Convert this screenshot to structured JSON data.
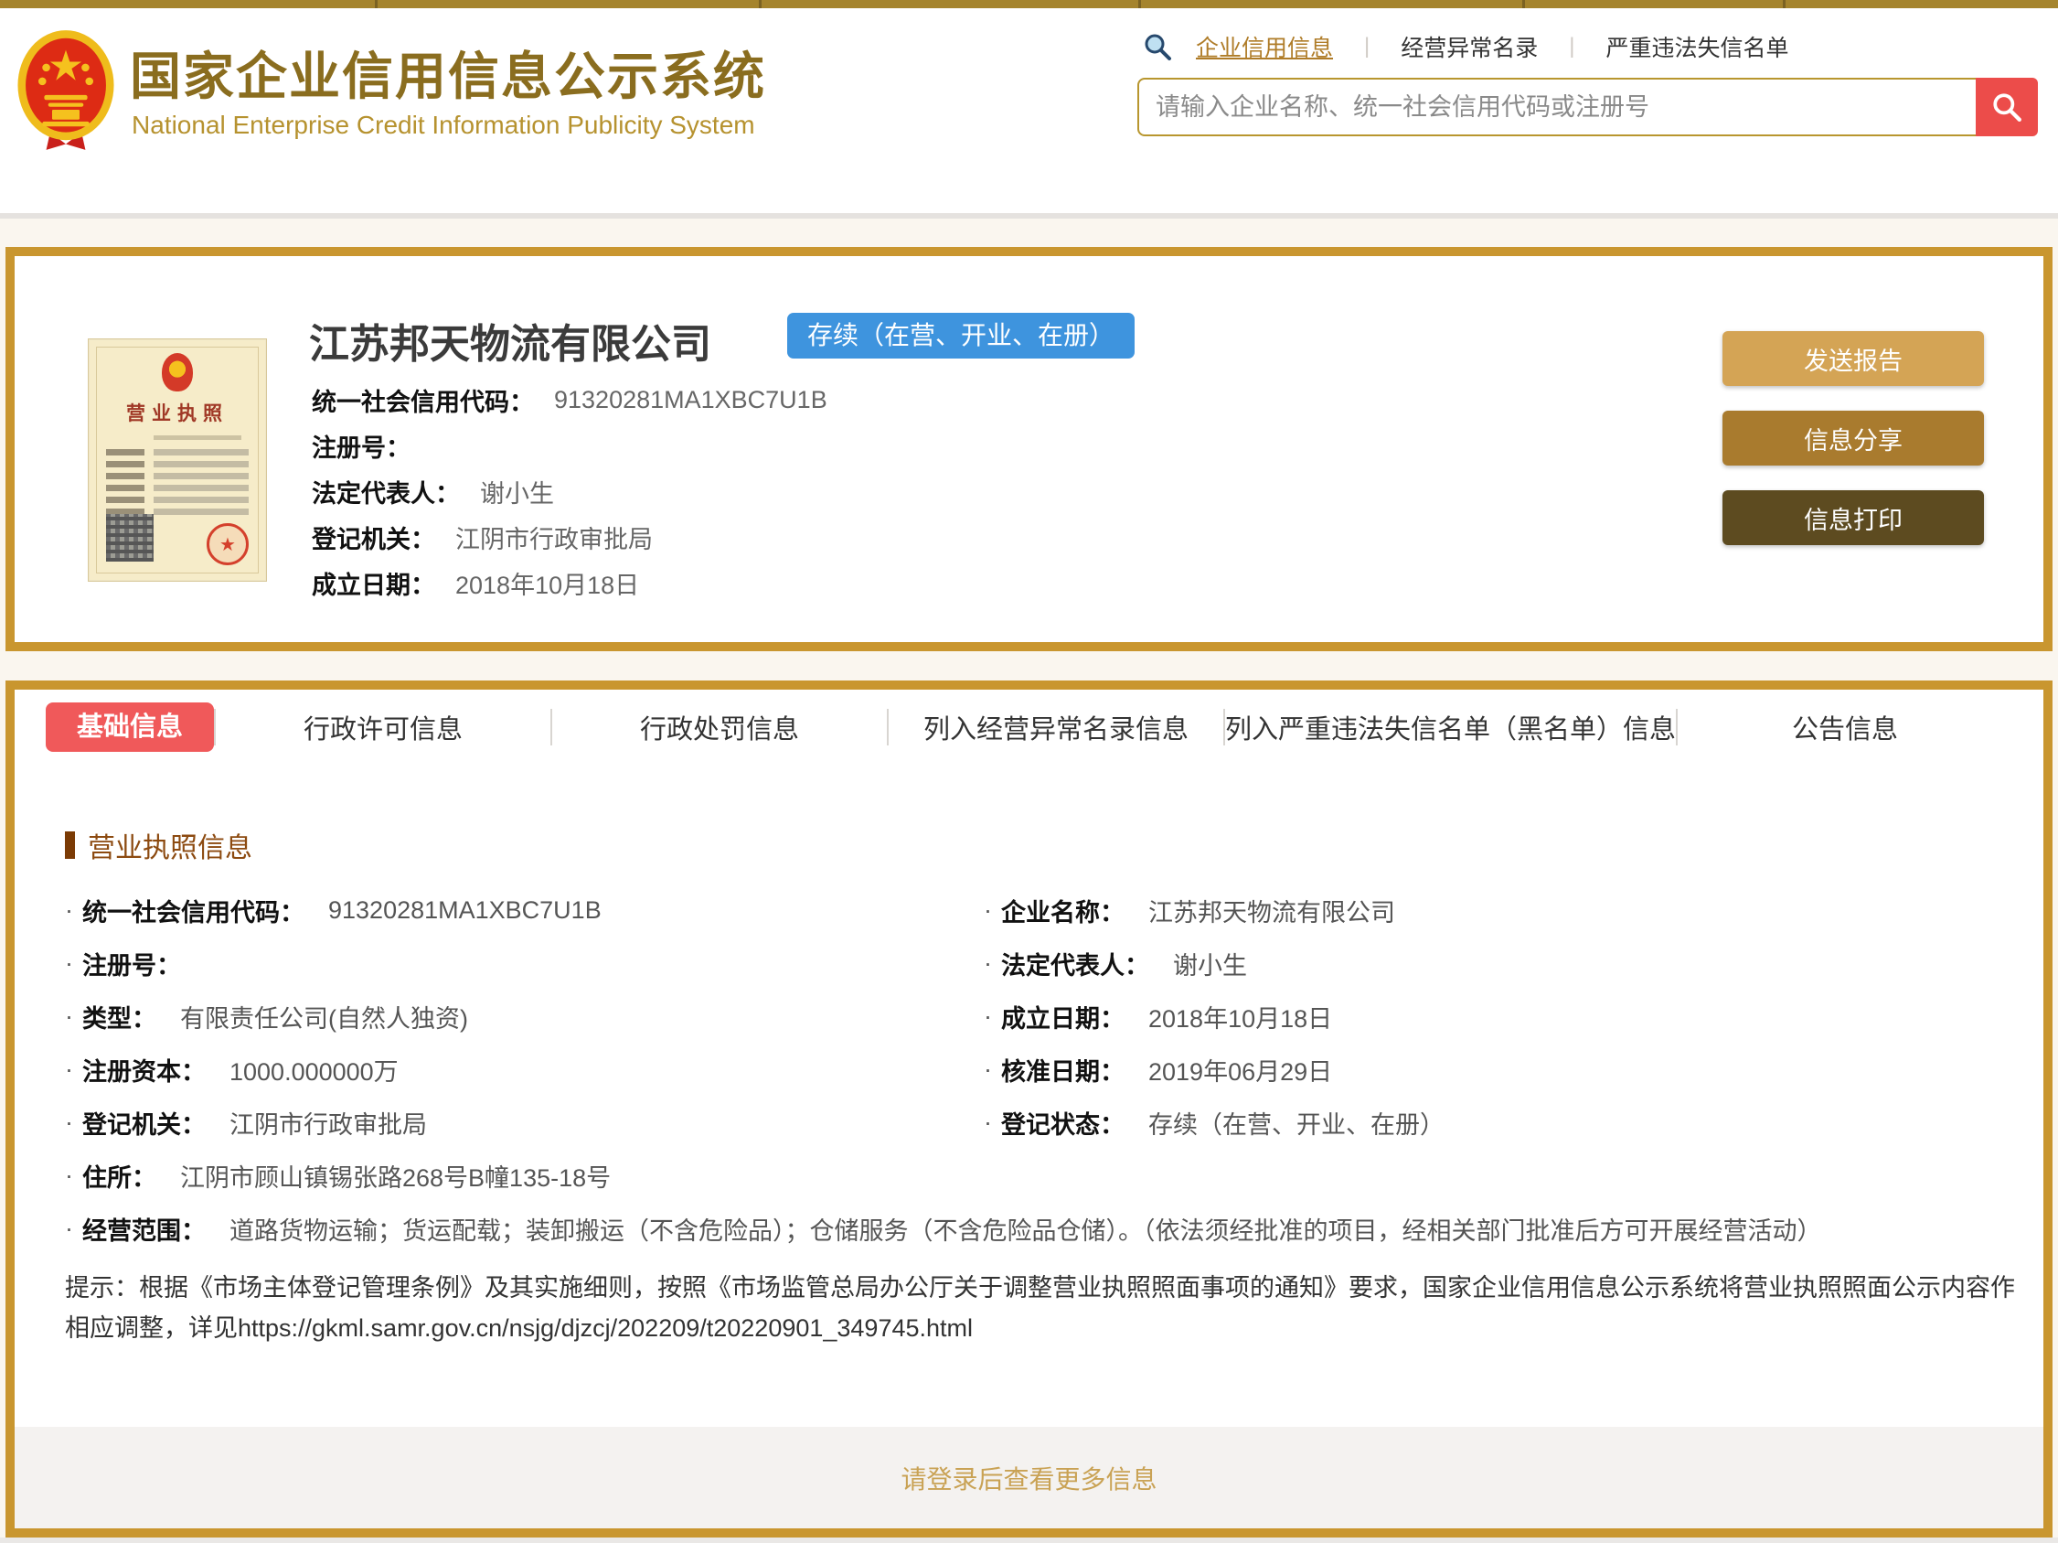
{
  "header": {
    "title_cn": "国家企业信用信息公示系统",
    "title_en": "National Enterprise Credit Information Publicity System",
    "nav": [
      {
        "label": "企业信用信息"
      },
      {
        "label": "经营异常名录"
      },
      {
        "label": "严重违法失信名单"
      }
    ],
    "search_placeholder": "请输入企业名称、统一社会信用代码或注册号"
  },
  "company": {
    "name": "江苏邦天物流有限公司",
    "status": "存续（在营、开业、在册）",
    "license_title": "营业执照",
    "fields": [
      {
        "label": "统一社会信用代码：",
        "value": "91320281MA1XBC7U1B"
      },
      {
        "label": "注册号：",
        "value": ""
      },
      {
        "label": "法定代表人：",
        "value": "谢小生"
      },
      {
        "label": "登记机关：",
        "value": "江阴市行政审批局"
      },
      {
        "label": "成立日期：",
        "value": "2018年10月18日"
      }
    ],
    "actions": [
      {
        "label": "发送报告"
      },
      {
        "label": "信息分享"
      },
      {
        "label": "信息打印"
      }
    ]
  },
  "tabs": [
    {
      "label": "基础信息",
      "active": true
    },
    {
      "label": "行政许可信息"
    },
    {
      "label": "行政处罚信息"
    },
    {
      "label": "列入经营异常名录信息"
    },
    {
      "label": "列入严重违法失信名单（黑名单）信息"
    },
    {
      "label": "公告信息"
    }
  ],
  "license_info": {
    "heading": "营业执照信息",
    "rows": [
      {
        "left_label": "统一社会信用代码：",
        "left_value": "91320281MA1XBC7U1B",
        "right_label": "企业名称：",
        "right_value": "江苏邦天物流有限公司"
      },
      {
        "left_label": "注册号：",
        "left_value": "",
        "right_label": "法定代表人：",
        "right_value": "谢小生"
      },
      {
        "left_label": "类型：",
        "left_value": "有限责任公司(自然人独资)",
        "right_label": "成立日期：",
        "right_value": "2018年10月18日"
      },
      {
        "left_label": "注册资本：",
        "left_value": "1000.000000万",
        "right_label": "核准日期：",
        "right_value": "2019年06月29日"
      },
      {
        "left_label": "登记机关：",
        "left_value": "江阴市行政审批局",
        "right_label": "登记状态：",
        "right_value": "存续（在营、开业、在册）"
      }
    ],
    "full_rows": [
      {
        "label": "住所：",
        "value": "江阴市顾山镇锡张路268号B幢135-18号"
      },
      {
        "label": "经营范围：",
        "value": "道路货物运输；货运配载；装卸搬运（不含危险品）；仓储服务（不含危险品仓储）。（依法须经批准的项目，经相关部门批准后方可开展经营活动）"
      }
    ],
    "hint": "提示：根据《市场主体登记管理条例》及其实施细则，按照《市场监管总局办公厅关于调整营业执照照面事项的通知》要求，国家企业信用信息公示系统将营业执照照面公示内容作相应调整，详见https://gkml.samr.gov.cn/nsjg/djzcj/202209/t20220901_349745.html"
  },
  "footer": {
    "login_hint": "请登录后查看更多信息"
  },
  "colors": {
    "gold_border": "#C9962F",
    "topbar_gold": "#A5842D",
    "active_tab_red": "#F0595A",
    "status_blue": "#3E94DE",
    "brand_gold": "#8A6D1F",
    "search_button_red": "#EC4C4A"
  }
}
